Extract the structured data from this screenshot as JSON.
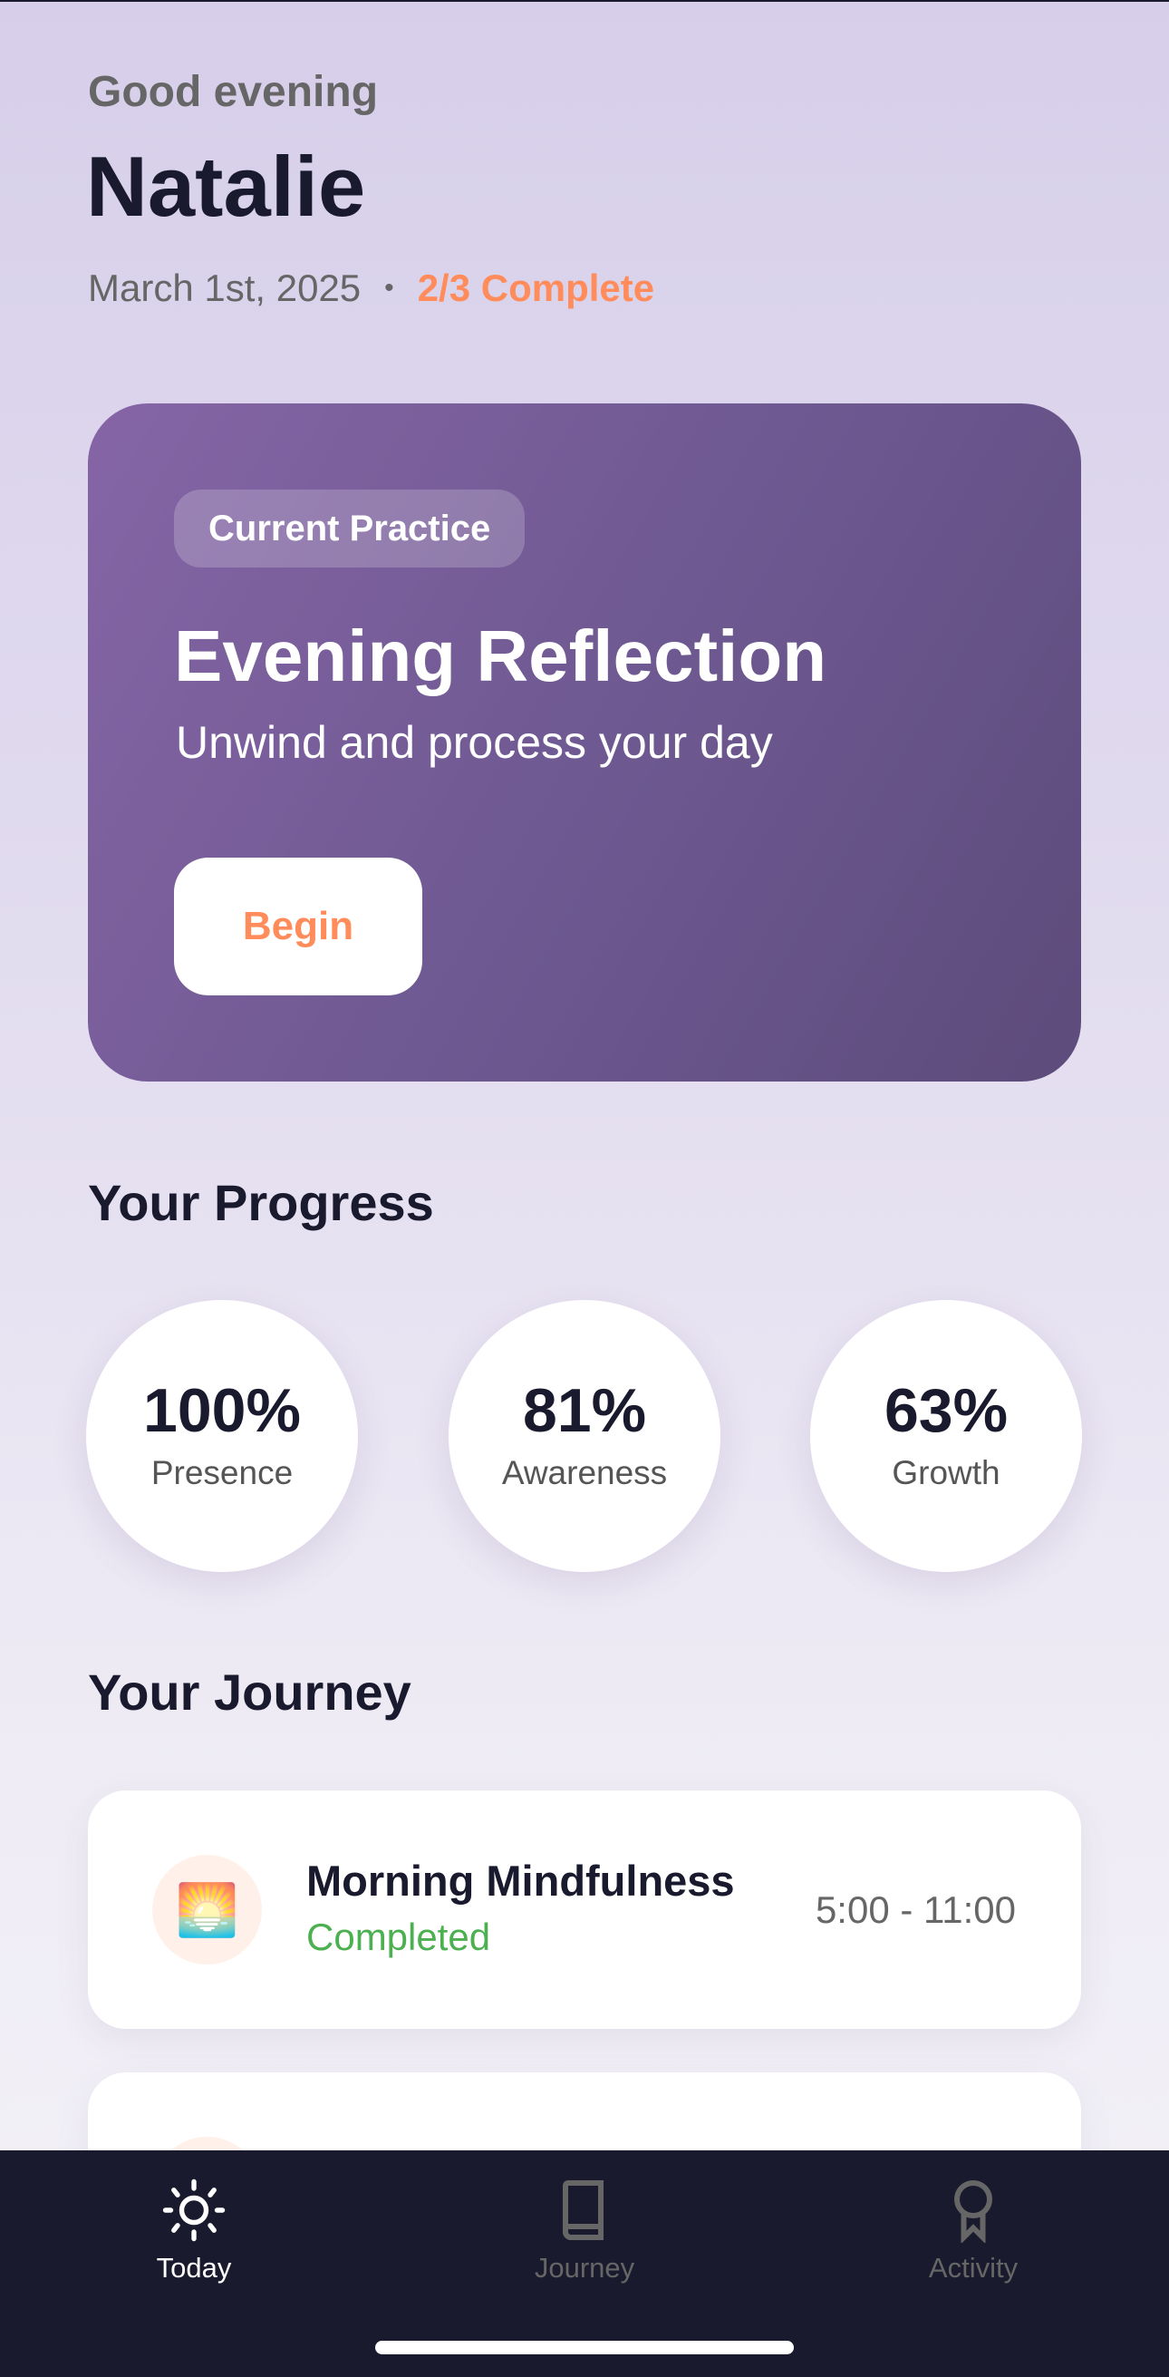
{
  "header": {
    "greeting": "Good evening",
    "name": "Natalie",
    "date": "March 1st, 2025",
    "separator": "•",
    "progress": "2/3 Complete"
  },
  "current_practice": {
    "badge": "Current Practice",
    "title": "Evening Reflection",
    "subtitle": "Unwind and process your day",
    "button": "Begin"
  },
  "progress": {
    "title": "Your Progress",
    "items": [
      {
        "value": "100%",
        "label": "Presence"
      },
      {
        "value": "81%",
        "label": "Awareness"
      },
      {
        "value": "63%",
        "label": "Growth"
      }
    ]
  },
  "journey": {
    "title": "Your Journey",
    "items": [
      {
        "icon": "🌅",
        "title": "Morning Mindfulness",
        "status": "Completed",
        "time": "5:00 - 11:00"
      }
    ]
  },
  "nav": {
    "tabs": [
      {
        "label": "Today",
        "icon": "sun-icon",
        "active": true
      },
      {
        "label": "Journey",
        "icon": "book-icon"
      },
      {
        "label": "Activity",
        "icon": "award-icon"
      }
    ]
  },
  "colors": {
    "accent": "#ff8c5a",
    "success": "#4caf50",
    "card": "#7a5d9c",
    "nav": "#1a1a2e"
  }
}
